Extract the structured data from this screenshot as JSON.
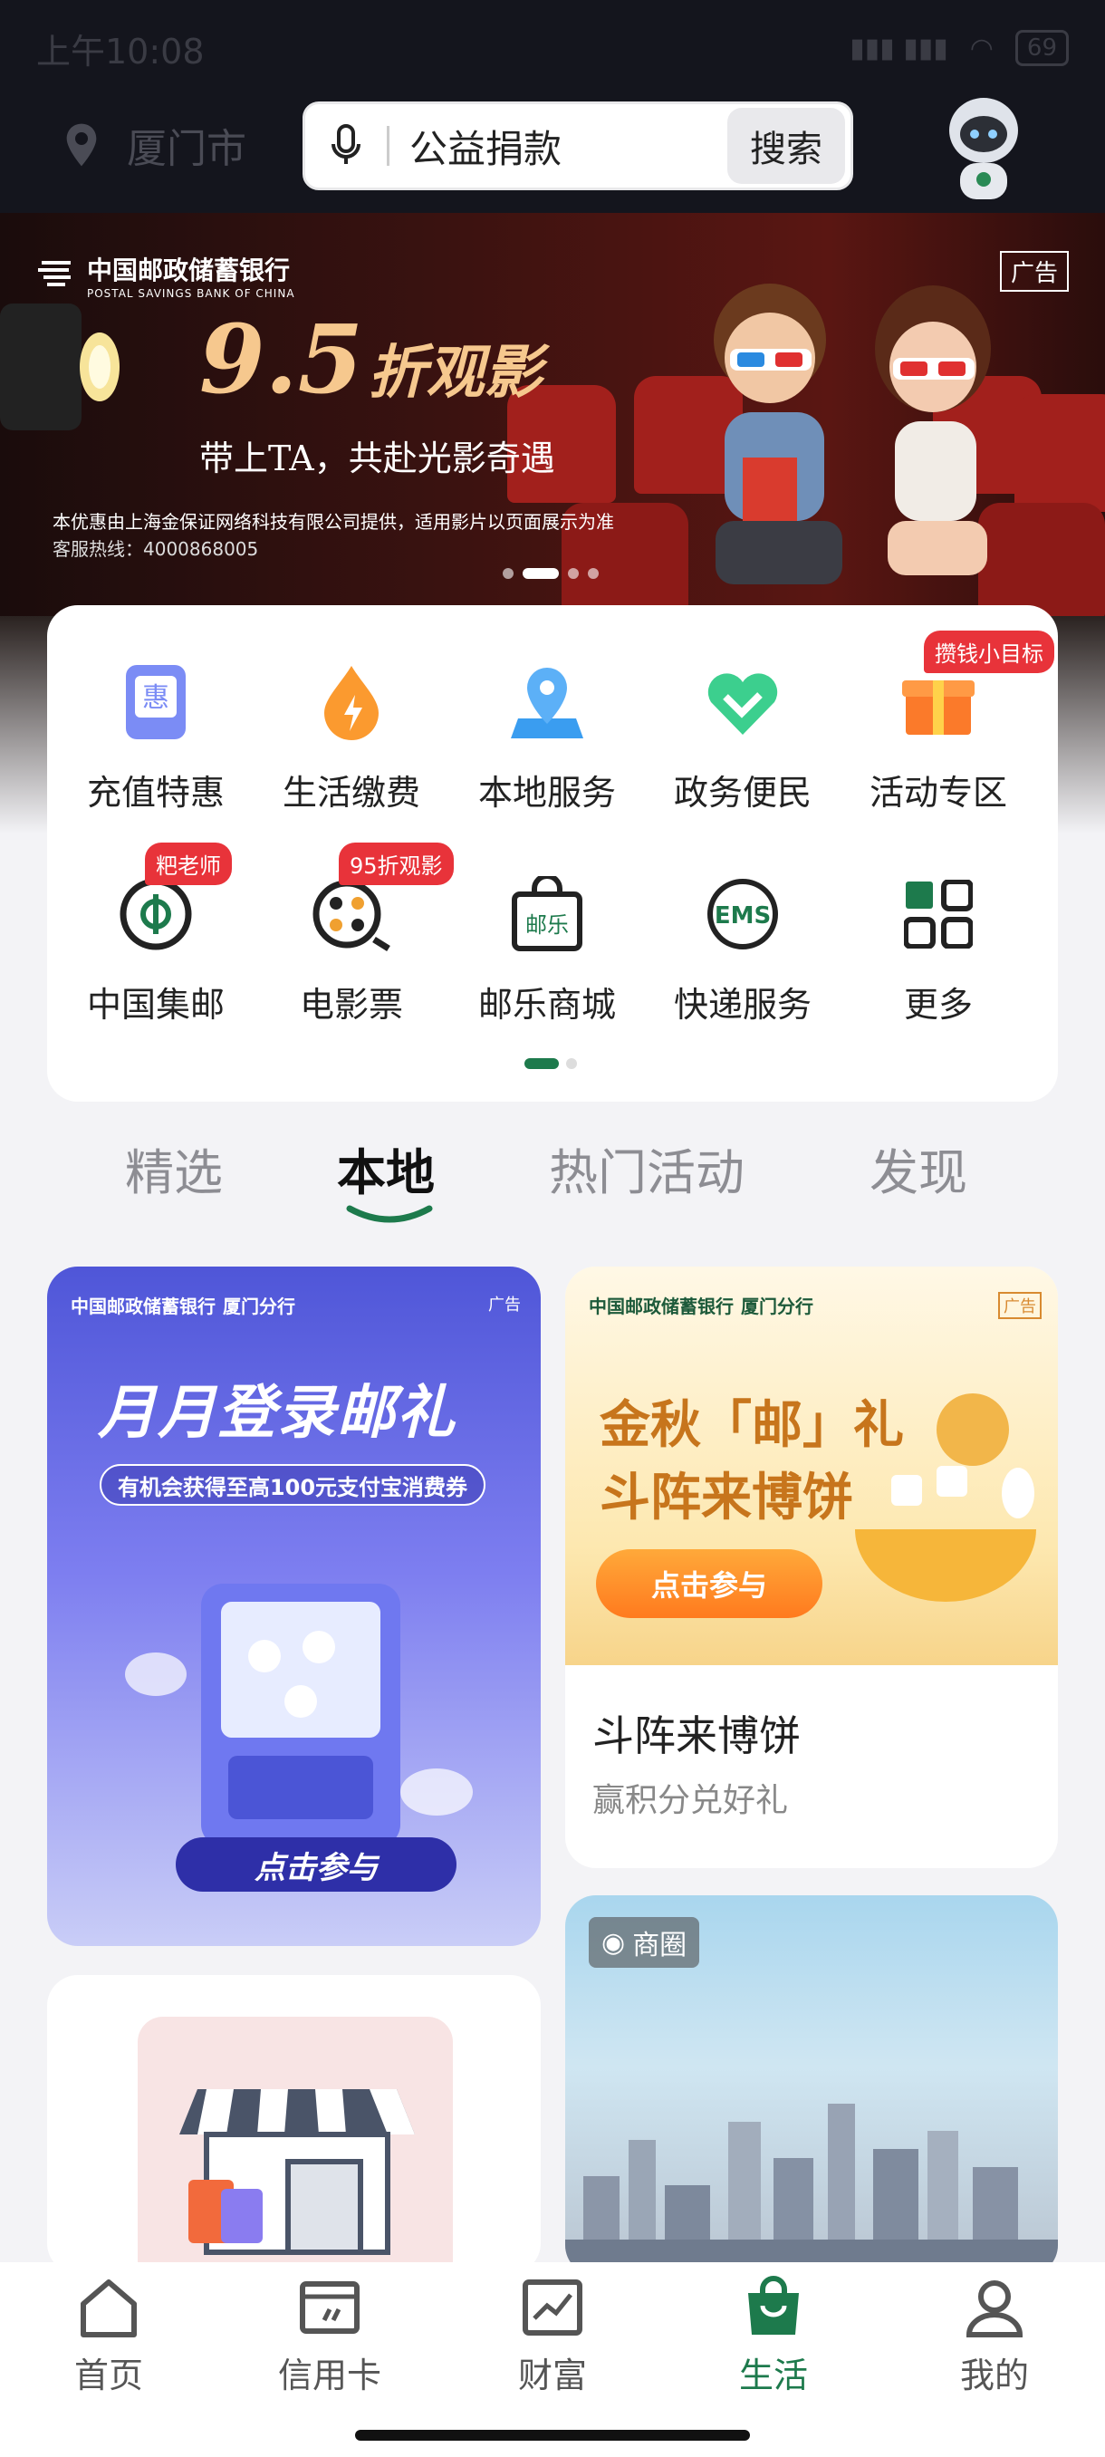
{
  "status_bar": {
    "time": "上午10:08",
    "battery": "69"
  },
  "header": {
    "location": "厦门市",
    "search_query": "公益捐款",
    "search_button": "搜索"
  },
  "banner": {
    "bank_name": "中国邮政储蓄银行",
    "bank_name_en": "POSTAL SAVINGS BANK OF CHINA",
    "ad_tag": "广告",
    "discount": "9.5",
    "discount_suffix": "折观影",
    "tagline": "带上TA，共赴光影奇遇",
    "fine_print": "本优惠由上海金保证网络科技有限公司提供，适用影片以页面展示为准",
    "hotline": "客服热线：4000868005"
  },
  "services": [
    {
      "label": "充值特惠",
      "icon": "recharge-icon"
    },
    {
      "label": "生活缴费",
      "icon": "utility-payment-icon"
    },
    {
      "label": "本地服务",
      "icon": "location-service-icon"
    },
    {
      "label": "政务便民",
      "icon": "government-heart-icon"
    },
    {
      "label": "活动专区",
      "icon": "gift-icon",
      "badge": "攒钱小目标"
    },
    {
      "label": "中国集邮",
      "icon": "stamp-collection-icon",
      "badge": "粑老师"
    },
    {
      "label": "电影票",
      "icon": "film-reel-icon",
      "badge": "95折观影"
    },
    {
      "label": "邮乐商城",
      "icon": "shopping-bag-icon"
    },
    {
      "label": "快递服务",
      "icon": "ems-icon"
    },
    {
      "label": "更多",
      "icon": "grid-more-icon"
    }
  ],
  "tabs": [
    {
      "label": "精选"
    },
    {
      "label": "本地"
    },
    {
      "label": "热门活动"
    },
    {
      "label": "发现"
    }
  ],
  "feed": {
    "card1": {
      "bank": "中国邮政储蓄银行",
      "branch": "厦门分行",
      "ad": "广告",
      "title": "月月登录邮礼",
      "subtitle": "有机会获得至高100元支付宝消费券",
      "cta": "点击参与"
    },
    "card2": {
      "bank": "中国邮政储蓄银行",
      "branch": "厦门分行",
      "ad": "广告",
      "title_line1": "金秋「邮」礼",
      "title_line2": "斗阵来博饼",
      "cta": "点击参与",
      "body_title": "斗阵来博饼",
      "body_sub": "赢积分兑好礼"
    },
    "card4": {
      "tag": "商圈"
    }
  },
  "bottom_nav": [
    {
      "label": "首页",
      "icon": "home-icon"
    },
    {
      "label": "信用卡",
      "icon": "credit-card-icon"
    },
    {
      "label": "财富",
      "icon": "wealth-chart-icon"
    },
    {
      "label": "生活",
      "icon": "shopping-bag-icon"
    },
    {
      "label": "我的",
      "icon": "profile-icon"
    }
  ],
  "colors": {
    "accent": "#1d7a4c",
    "badge": "#e8333a",
    "header_bg": "#14151d"
  }
}
